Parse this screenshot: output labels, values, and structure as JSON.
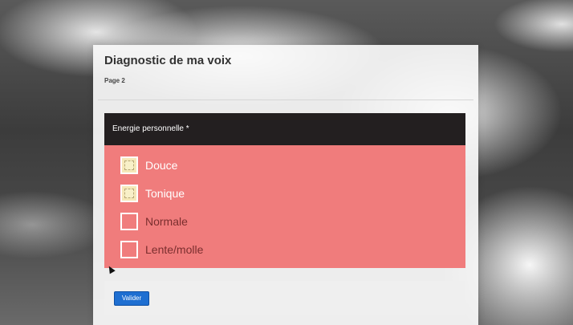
{
  "form": {
    "title": "Diagnostic de ma voix",
    "page_label": "Page 2"
  },
  "question": {
    "label": "Energie personnelle *",
    "options": [
      {
        "label": "Douce",
        "checked": true
      },
      {
        "label": "Tonique",
        "checked": true
      },
      {
        "label": "Normale",
        "checked": false
      },
      {
        "label": "Lente/molle",
        "checked": false
      }
    ]
  },
  "footer": {
    "submit_label": "Valider"
  },
  "colors": {
    "header_bg": "#231f20",
    "options_bg": "#f07c7c",
    "submit_bg": "#1f6fd1"
  }
}
